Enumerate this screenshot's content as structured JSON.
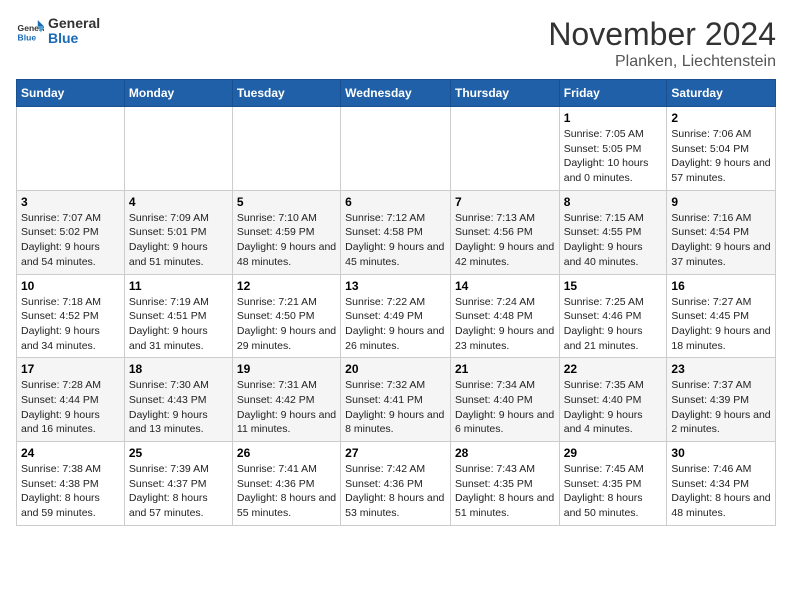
{
  "logo": {
    "line1": "General",
    "line2": "Blue"
  },
  "title": "November 2024",
  "location": "Planken, Liechtenstein",
  "weekdays": [
    "Sunday",
    "Monday",
    "Tuesday",
    "Wednesday",
    "Thursday",
    "Friday",
    "Saturday"
  ],
  "weeks": [
    [
      {
        "day": "",
        "info": ""
      },
      {
        "day": "",
        "info": ""
      },
      {
        "day": "",
        "info": ""
      },
      {
        "day": "",
        "info": ""
      },
      {
        "day": "",
        "info": ""
      },
      {
        "day": "1",
        "info": "Sunrise: 7:05 AM\nSunset: 5:05 PM\nDaylight: 10 hours and 0 minutes."
      },
      {
        "day": "2",
        "info": "Sunrise: 7:06 AM\nSunset: 5:04 PM\nDaylight: 9 hours and 57 minutes."
      }
    ],
    [
      {
        "day": "3",
        "info": "Sunrise: 7:07 AM\nSunset: 5:02 PM\nDaylight: 9 hours and 54 minutes."
      },
      {
        "day": "4",
        "info": "Sunrise: 7:09 AM\nSunset: 5:01 PM\nDaylight: 9 hours and 51 minutes."
      },
      {
        "day": "5",
        "info": "Sunrise: 7:10 AM\nSunset: 4:59 PM\nDaylight: 9 hours and 48 minutes."
      },
      {
        "day": "6",
        "info": "Sunrise: 7:12 AM\nSunset: 4:58 PM\nDaylight: 9 hours and 45 minutes."
      },
      {
        "day": "7",
        "info": "Sunrise: 7:13 AM\nSunset: 4:56 PM\nDaylight: 9 hours and 42 minutes."
      },
      {
        "day": "8",
        "info": "Sunrise: 7:15 AM\nSunset: 4:55 PM\nDaylight: 9 hours and 40 minutes."
      },
      {
        "day": "9",
        "info": "Sunrise: 7:16 AM\nSunset: 4:54 PM\nDaylight: 9 hours and 37 minutes."
      }
    ],
    [
      {
        "day": "10",
        "info": "Sunrise: 7:18 AM\nSunset: 4:52 PM\nDaylight: 9 hours and 34 minutes."
      },
      {
        "day": "11",
        "info": "Sunrise: 7:19 AM\nSunset: 4:51 PM\nDaylight: 9 hours and 31 minutes."
      },
      {
        "day": "12",
        "info": "Sunrise: 7:21 AM\nSunset: 4:50 PM\nDaylight: 9 hours and 29 minutes."
      },
      {
        "day": "13",
        "info": "Sunrise: 7:22 AM\nSunset: 4:49 PM\nDaylight: 9 hours and 26 minutes."
      },
      {
        "day": "14",
        "info": "Sunrise: 7:24 AM\nSunset: 4:48 PM\nDaylight: 9 hours and 23 minutes."
      },
      {
        "day": "15",
        "info": "Sunrise: 7:25 AM\nSunset: 4:46 PM\nDaylight: 9 hours and 21 minutes."
      },
      {
        "day": "16",
        "info": "Sunrise: 7:27 AM\nSunset: 4:45 PM\nDaylight: 9 hours and 18 minutes."
      }
    ],
    [
      {
        "day": "17",
        "info": "Sunrise: 7:28 AM\nSunset: 4:44 PM\nDaylight: 9 hours and 16 minutes."
      },
      {
        "day": "18",
        "info": "Sunrise: 7:30 AM\nSunset: 4:43 PM\nDaylight: 9 hours and 13 minutes."
      },
      {
        "day": "19",
        "info": "Sunrise: 7:31 AM\nSunset: 4:42 PM\nDaylight: 9 hours and 11 minutes."
      },
      {
        "day": "20",
        "info": "Sunrise: 7:32 AM\nSunset: 4:41 PM\nDaylight: 9 hours and 8 minutes."
      },
      {
        "day": "21",
        "info": "Sunrise: 7:34 AM\nSunset: 4:40 PM\nDaylight: 9 hours and 6 minutes."
      },
      {
        "day": "22",
        "info": "Sunrise: 7:35 AM\nSunset: 4:40 PM\nDaylight: 9 hours and 4 minutes."
      },
      {
        "day": "23",
        "info": "Sunrise: 7:37 AM\nSunset: 4:39 PM\nDaylight: 9 hours and 2 minutes."
      }
    ],
    [
      {
        "day": "24",
        "info": "Sunrise: 7:38 AM\nSunset: 4:38 PM\nDaylight: 8 hours and 59 minutes."
      },
      {
        "day": "25",
        "info": "Sunrise: 7:39 AM\nSunset: 4:37 PM\nDaylight: 8 hours and 57 minutes."
      },
      {
        "day": "26",
        "info": "Sunrise: 7:41 AM\nSunset: 4:36 PM\nDaylight: 8 hours and 55 minutes."
      },
      {
        "day": "27",
        "info": "Sunrise: 7:42 AM\nSunset: 4:36 PM\nDaylight: 8 hours and 53 minutes."
      },
      {
        "day": "28",
        "info": "Sunrise: 7:43 AM\nSunset: 4:35 PM\nDaylight: 8 hours and 51 minutes."
      },
      {
        "day": "29",
        "info": "Sunrise: 7:45 AM\nSunset: 4:35 PM\nDaylight: 8 hours and 50 minutes."
      },
      {
        "day": "30",
        "info": "Sunrise: 7:46 AM\nSunset: 4:34 PM\nDaylight: 8 hours and 48 minutes."
      }
    ]
  ]
}
